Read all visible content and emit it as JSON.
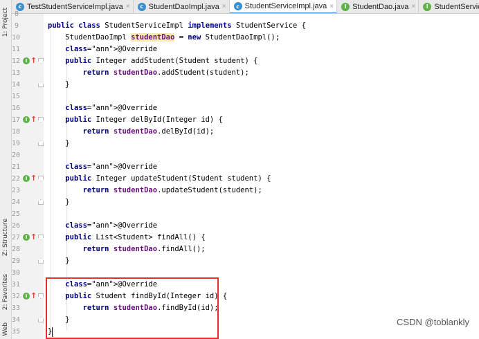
{
  "tabs": [
    {
      "label": "TestStudentServiceImpl.java",
      "icon": "class-icon",
      "active": false
    },
    {
      "label": "StudentDaoImpl.java",
      "icon": "class-icon",
      "active": false
    },
    {
      "label": "StudentServiceImpl.java",
      "icon": "class-icon",
      "active": true
    },
    {
      "label": "StudentDao.java",
      "icon": "interface-icon",
      "active": false
    },
    {
      "label": "StudentService.java",
      "icon": "interface-icon",
      "active": false
    }
  ],
  "tab_icon_letters": {
    "class": "c",
    "interface": "I"
  },
  "tab_close_glyph": "×",
  "tool_windows": {
    "project": "1: Project",
    "structure": "Z: Structure",
    "favorites": "2: Favorites",
    "web": "Web"
  },
  "lines": [
    {
      "n": "8",
      "text": ""
    },
    {
      "n": "9",
      "text": "public class StudentServiceImpl implements StudentService {"
    },
    {
      "n": "10",
      "text": "    StudentDaoImpl studentDao = new StudentDaoImpl();"
    },
    {
      "n": "11",
      "text": "    @Override"
    },
    {
      "n": "12",
      "text": "    public Integer addStudent(Student student) {"
    },
    {
      "n": "13",
      "text": "        return studentDao.addStudent(student);"
    },
    {
      "n": "14",
      "text": "    }"
    },
    {
      "n": "15",
      "text": ""
    },
    {
      "n": "16",
      "text": "    @Override"
    },
    {
      "n": "17",
      "text": "    public Integer delById(Integer id) {"
    },
    {
      "n": "18",
      "text": "        return studentDao.delById(id);"
    },
    {
      "n": "19",
      "text": "    }"
    },
    {
      "n": "20",
      "text": ""
    },
    {
      "n": "21",
      "text": "    @Override"
    },
    {
      "n": "22",
      "text": "    public Integer updateStudent(Student student) {"
    },
    {
      "n": "23",
      "text": "        return studentDao.updateStudent(student);"
    },
    {
      "n": "24",
      "text": "    }"
    },
    {
      "n": "25",
      "text": ""
    },
    {
      "n": "26",
      "text": "    @Override"
    },
    {
      "n": "27",
      "text": "    public List<Student> findAll() {"
    },
    {
      "n": "28",
      "text": "        return studentDao.findAll();"
    },
    {
      "n": "29",
      "text": "    }"
    },
    {
      "n": "30",
      "text": ""
    },
    {
      "n": "31",
      "text": "    @Override"
    },
    {
      "n": "32",
      "text": "    public Student findById(Integer id) {"
    },
    {
      "n": "33",
      "text": "        return studentDao.findById(id);"
    },
    {
      "n": "34",
      "text": "    }"
    },
    {
      "n": "35",
      "text": "}"
    }
  ],
  "impl_marker_lines": [
    "12",
    "17",
    "22",
    "27",
    "32"
  ],
  "impl_marker_letter": "I",
  "impl_arrow_glyph": "↑",
  "watermark": "CSDN @toblankly",
  "colors": {
    "keyword": "#000080",
    "annotation": "#808000",
    "field": "#660e7a",
    "highlight_box": "#e0302b",
    "active_tab_underline": "#4a90d9"
  }
}
